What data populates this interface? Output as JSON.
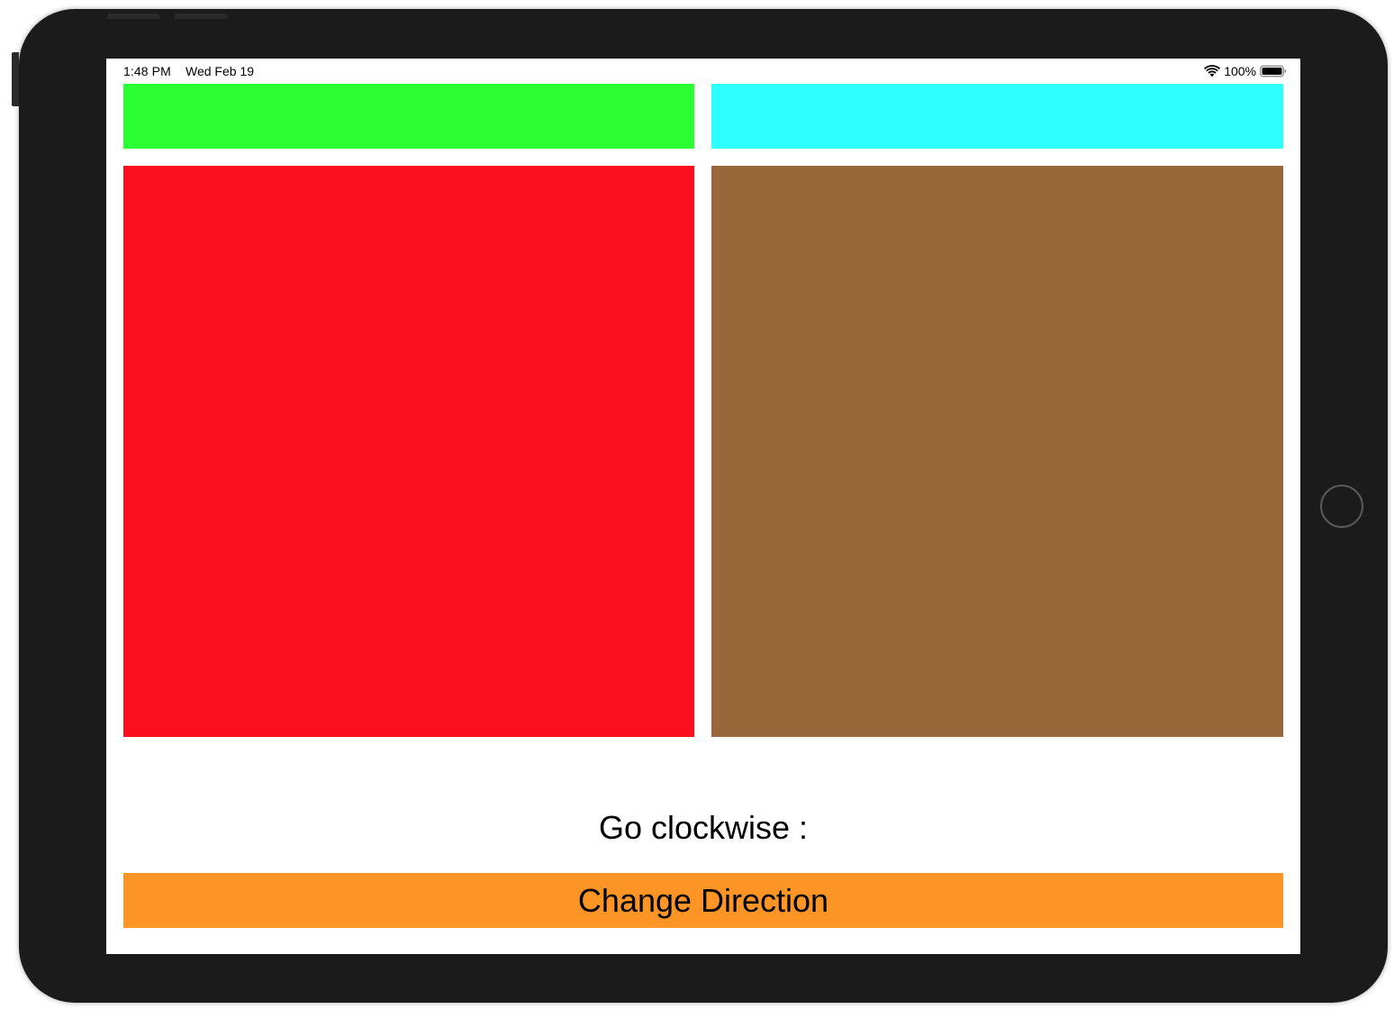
{
  "status_bar": {
    "time": "1:48 PM",
    "date": "Wed Feb 19",
    "battery_percent": "100%",
    "wifi_icon": "wifi-icon",
    "battery_icon": "battery-full-icon"
  },
  "colors": {
    "device_frame": "#1b1b1b",
    "screen_background": "#ffffff",
    "top_left_box": "#2bff33",
    "top_right_box": "#2effff",
    "bottom_left_box": "#fb0f1f",
    "bottom_right_box": "#99673a",
    "button_background": "#fc9526"
  },
  "direction_label": "Go clockwise :",
  "change_button_label": "Change Direction"
}
